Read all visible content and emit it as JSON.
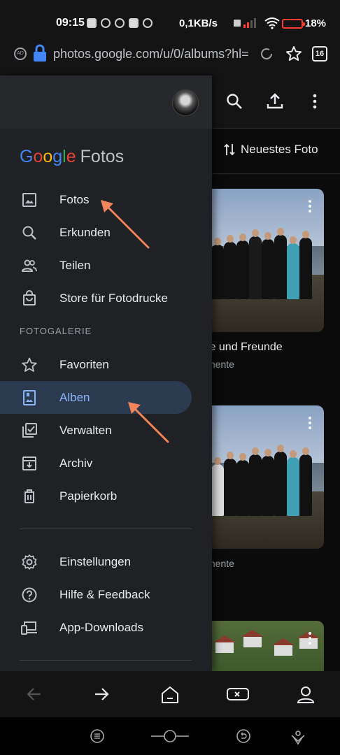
{
  "status_bar": {
    "time": "09:15",
    "network_speed": "0,1KB/s",
    "battery_percent": "18%"
  },
  "url_bar": {
    "url": "photos.google.com/u/0/albums?hl=",
    "tab_count": "16"
  },
  "toolbar": {
    "sort_label": "Neuestes Foto"
  },
  "drawer": {
    "brand_google": [
      "G",
      "o",
      "o",
      "g",
      "l",
      "e"
    ],
    "brand_product": "Fotos",
    "items_top": [
      {
        "label": "Fotos",
        "icon": "image-icon"
      },
      {
        "label": "Erkunden",
        "icon": "search-icon"
      },
      {
        "label": "Teilen",
        "icon": "people-icon"
      },
      {
        "label": "Store für Fotodrucke",
        "icon": "shopping-bag-icon"
      }
    ],
    "section_label": "FOTOGALERIE",
    "items_gallery": [
      {
        "label": "Favoriten",
        "icon": "star-icon"
      },
      {
        "label": "Alben",
        "icon": "album-icon",
        "active": true
      },
      {
        "label": "Verwalten",
        "icon": "manage-icon"
      },
      {
        "label": "Archiv",
        "icon": "archive-icon"
      },
      {
        "label": "Papierkorb",
        "icon": "trash-icon"
      }
    ],
    "items_bottom": [
      {
        "label": "Einstellungen",
        "icon": "settings-icon"
      },
      {
        "label": "Hilfe & Feedback",
        "icon": "help-icon"
      },
      {
        "label": "App-Downloads",
        "icon": "devices-icon"
      }
    ]
  },
  "albums": [
    {
      "title": "ie und Freunde",
      "count": "mente"
    },
    {
      "title": "",
      "count": "mente"
    }
  ],
  "colors": {
    "drawer_bg": "#202124",
    "active_bg": "#2c3a50",
    "active_text": "#8ab4f8",
    "arrow": "#f0845a",
    "google_blue": "#4285f4",
    "google_red": "#ea4335",
    "google_yellow": "#fbbc05",
    "google_green": "#34a853"
  }
}
